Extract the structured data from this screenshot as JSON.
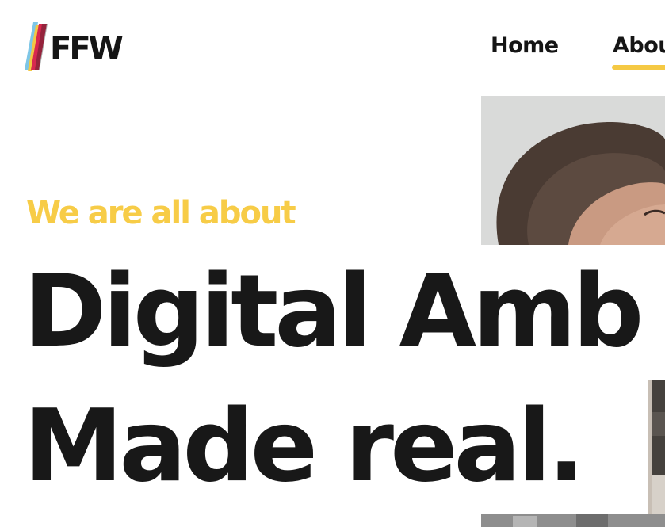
{
  "header": {
    "logo": {
      "text": "FFW",
      "stripe_colors": [
        "#7ec6e6",
        "#f2c844",
        "#d8284f",
        "#1a1a1a"
      ]
    },
    "nav": {
      "items": [
        {
          "label": "Home",
          "active": false
        },
        {
          "label": "About",
          "active": true
        }
      ],
      "active_underline_color": "#f5c944"
    }
  },
  "hero": {
    "eyebrow": "We are all about",
    "headline_line1": "Digital Amb",
    "headline_line2": "Made real.",
    "colors": {
      "eyebrow": "#f7cc47",
      "headline": "#181818",
      "background": "#ffffff"
    }
  },
  "images": {
    "top_photo": "smiling-woman-photo",
    "bottom_photo": "person-photo"
  }
}
